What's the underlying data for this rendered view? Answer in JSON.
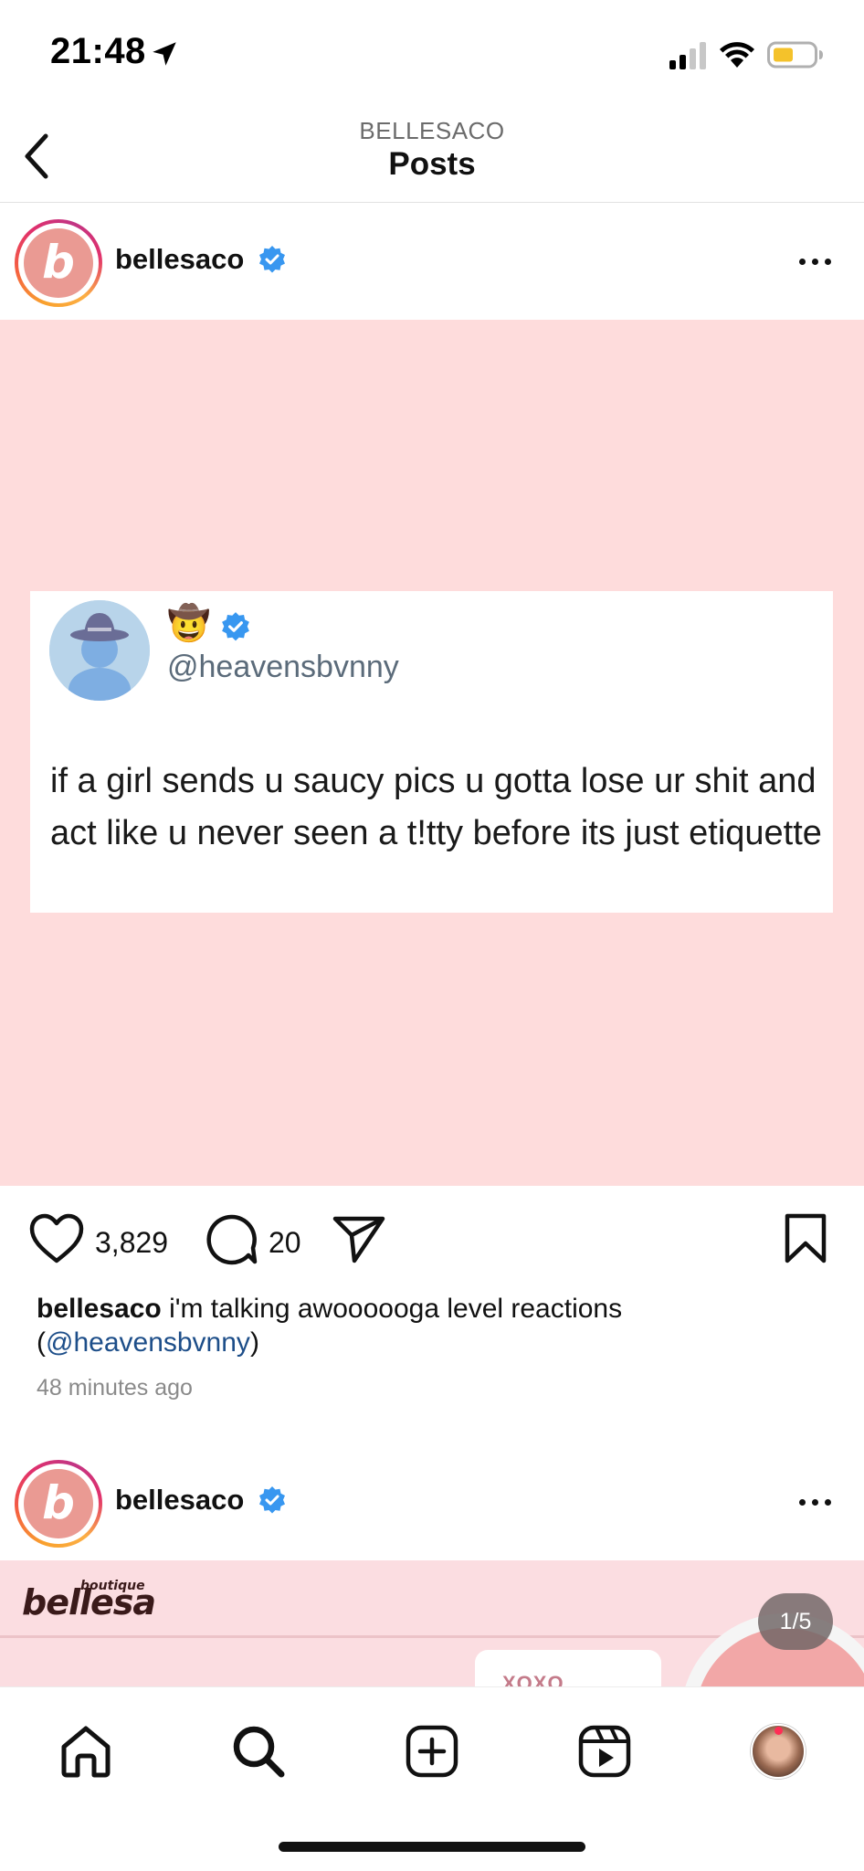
{
  "status_bar": {
    "time": "21:48",
    "icons": [
      "location-arrow-icon",
      "signal-icon",
      "wifi-icon",
      "battery-icon"
    ],
    "battery_color": "#f4c22b"
  },
  "header": {
    "subtitle": "BELLESACO",
    "title": "Posts"
  },
  "posts": [
    {
      "username": "bellesaco",
      "avatar_letter": "b",
      "tweet": {
        "emoji": "🤠",
        "handle": "@heavensbvnny",
        "text": "if a girl sends u saucy pics u gotta lose ur shit and act like u never seen a t!tty before its just etiquette"
      },
      "likes": "3,829",
      "comments": "20",
      "caption_user": "bellesaco",
      "caption_text": "i'm talking awoooooga level reactions",
      "caption_paren_open": "(",
      "caption_mention": "@heavensbvnny",
      "caption_paren_close": ")",
      "timestamp": "48 minutes ago"
    },
    {
      "username": "bellesaco",
      "avatar_letter": "b",
      "brand_logo": "bellesa",
      "brand_sub": "boutique",
      "card_text": "XOXO",
      "slide_counter": "1/5"
    }
  ],
  "colors": {
    "post_bg": "#fedcdc",
    "verified_blue": "#3897f0",
    "mention": "#1d4e89",
    "notification": "#ff2d55"
  },
  "bottom_nav": [
    "home-icon",
    "search-icon",
    "create-icon",
    "reels-icon",
    "profile-avatar"
  ]
}
